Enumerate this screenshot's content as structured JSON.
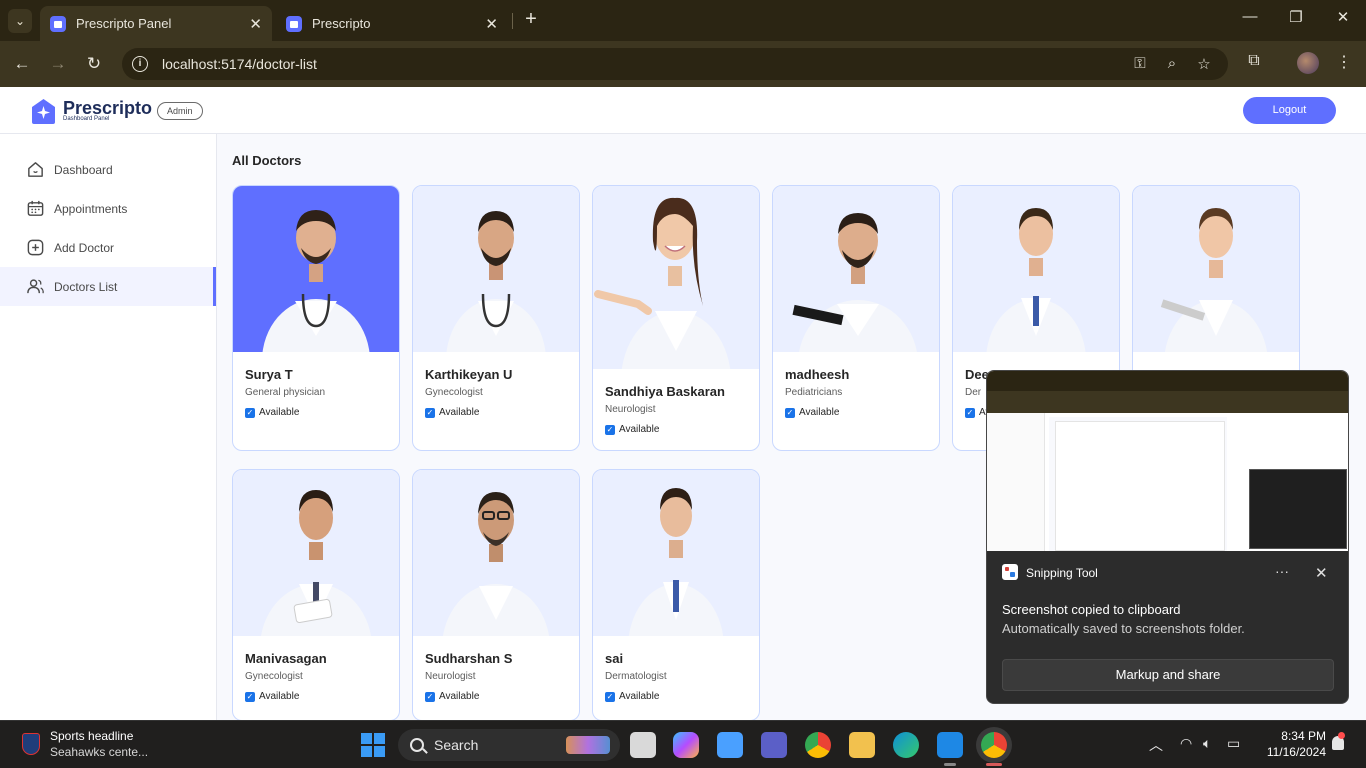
{
  "browser": {
    "tabs": [
      {
        "title": "Prescripto Panel",
        "active": true
      },
      {
        "title": "Prescripto",
        "active": false
      }
    ],
    "url": "localhost:5174/doctor-list"
  },
  "header": {
    "brand": "Prescripto",
    "brand_sub": "Dashboard Panel",
    "role_badge": "Admin",
    "logout_label": "Logout",
    "accent": "#5f6fff"
  },
  "sidebar": {
    "items": [
      {
        "label": "Dashboard",
        "icon": "home-icon",
        "active": false
      },
      {
        "label": "Appointments",
        "icon": "calendar-icon",
        "active": false
      },
      {
        "label": "Add Doctor",
        "icon": "add-icon",
        "active": false
      },
      {
        "label": "Doctors List",
        "icon": "people-icon",
        "active": true
      }
    ]
  },
  "main": {
    "title": "All Doctors",
    "available_label": "Available",
    "doctors": [
      {
        "name": "Surya T",
        "speciality": "General physician",
        "available": true
      },
      {
        "name": "Karthikeyan U",
        "speciality": "Gynecologist",
        "available": true
      },
      {
        "name": "Sandhiya Baskaran",
        "speciality": "Neurologist",
        "available": true
      },
      {
        "name": "madheesh",
        "speciality": "Pediatricians",
        "available": true
      },
      {
        "name": "Dee",
        "speciality": "Der",
        "available": true
      },
      {
        "name": "",
        "speciality": "",
        "available": true
      },
      {
        "name": "Manivasagan",
        "speciality": "Gynecologist",
        "available": true
      },
      {
        "name": "Sudharshan S",
        "speciality": "Neurologist",
        "available": true
      },
      {
        "name": "sai",
        "speciality": "Dermatologist",
        "available": true
      }
    ]
  },
  "toast": {
    "app_name": "Snipping Tool",
    "more_label": "···",
    "title": "Screenshot copied to clipboard",
    "body": "Automatically saved to screenshots folder.",
    "button_label": "Markup and share"
  },
  "taskbar": {
    "news_headline": "Sports headline",
    "news_sub": "Seahawks cente...",
    "search_label": "Search",
    "time": "8:34 PM",
    "date": "11/16/2024"
  }
}
